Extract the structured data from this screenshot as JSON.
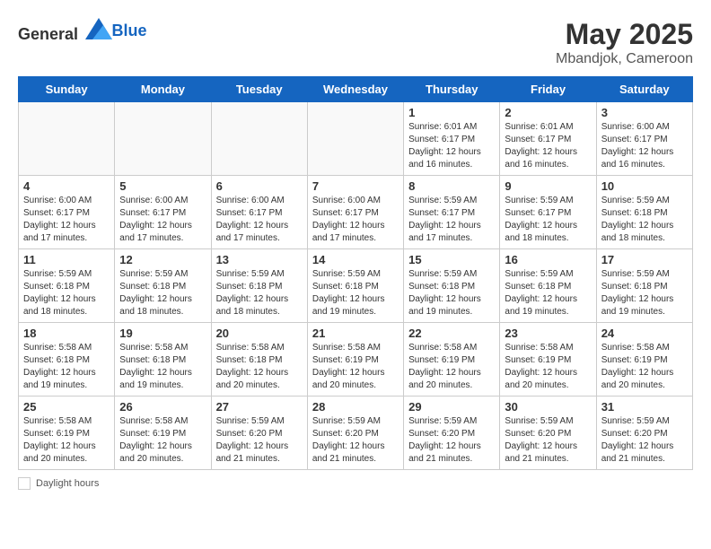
{
  "header": {
    "logo_general": "General",
    "logo_blue": "Blue",
    "month_year": "May 2025",
    "location": "Mbandjok, Cameroon"
  },
  "days_of_week": [
    "Sunday",
    "Monday",
    "Tuesday",
    "Wednesday",
    "Thursday",
    "Friday",
    "Saturday"
  ],
  "weeks": [
    [
      {
        "day": "",
        "info": ""
      },
      {
        "day": "",
        "info": ""
      },
      {
        "day": "",
        "info": ""
      },
      {
        "day": "",
        "info": ""
      },
      {
        "day": "1",
        "info": "Sunrise: 6:01 AM\nSunset: 6:17 PM\nDaylight: 12 hours\nand 16 minutes."
      },
      {
        "day": "2",
        "info": "Sunrise: 6:01 AM\nSunset: 6:17 PM\nDaylight: 12 hours\nand 16 minutes."
      },
      {
        "day": "3",
        "info": "Sunrise: 6:00 AM\nSunset: 6:17 PM\nDaylight: 12 hours\nand 16 minutes."
      }
    ],
    [
      {
        "day": "4",
        "info": "Sunrise: 6:00 AM\nSunset: 6:17 PM\nDaylight: 12 hours\nand 17 minutes."
      },
      {
        "day": "5",
        "info": "Sunrise: 6:00 AM\nSunset: 6:17 PM\nDaylight: 12 hours\nand 17 minutes."
      },
      {
        "day": "6",
        "info": "Sunrise: 6:00 AM\nSunset: 6:17 PM\nDaylight: 12 hours\nand 17 minutes."
      },
      {
        "day": "7",
        "info": "Sunrise: 6:00 AM\nSunset: 6:17 PM\nDaylight: 12 hours\nand 17 minutes."
      },
      {
        "day": "8",
        "info": "Sunrise: 5:59 AM\nSunset: 6:17 PM\nDaylight: 12 hours\nand 17 minutes."
      },
      {
        "day": "9",
        "info": "Sunrise: 5:59 AM\nSunset: 6:17 PM\nDaylight: 12 hours\nand 18 minutes."
      },
      {
        "day": "10",
        "info": "Sunrise: 5:59 AM\nSunset: 6:18 PM\nDaylight: 12 hours\nand 18 minutes."
      }
    ],
    [
      {
        "day": "11",
        "info": "Sunrise: 5:59 AM\nSunset: 6:18 PM\nDaylight: 12 hours\nand 18 minutes."
      },
      {
        "day": "12",
        "info": "Sunrise: 5:59 AM\nSunset: 6:18 PM\nDaylight: 12 hours\nand 18 minutes."
      },
      {
        "day": "13",
        "info": "Sunrise: 5:59 AM\nSunset: 6:18 PM\nDaylight: 12 hours\nand 18 minutes."
      },
      {
        "day": "14",
        "info": "Sunrise: 5:59 AM\nSunset: 6:18 PM\nDaylight: 12 hours\nand 19 minutes."
      },
      {
        "day": "15",
        "info": "Sunrise: 5:59 AM\nSunset: 6:18 PM\nDaylight: 12 hours\nand 19 minutes."
      },
      {
        "day": "16",
        "info": "Sunrise: 5:59 AM\nSunset: 6:18 PM\nDaylight: 12 hours\nand 19 minutes."
      },
      {
        "day": "17",
        "info": "Sunrise: 5:59 AM\nSunset: 6:18 PM\nDaylight: 12 hours\nand 19 minutes."
      }
    ],
    [
      {
        "day": "18",
        "info": "Sunrise: 5:58 AM\nSunset: 6:18 PM\nDaylight: 12 hours\nand 19 minutes."
      },
      {
        "day": "19",
        "info": "Sunrise: 5:58 AM\nSunset: 6:18 PM\nDaylight: 12 hours\nand 19 minutes."
      },
      {
        "day": "20",
        "info": "Sunrise: 5:58 AM\nSunset: 6:18 PM\nDaylight: 12 hours\nand 20 minutes."
      },
      {
        "day": "21",
        "info": "Sunrise: 5:58 AM\nSunset: 6:19 PM\nDaylight: 12 hours\nand 20 minutes."
      },
      {
        "day": "22",
        "info": "Sunrise: 5:58 AM\nSunset: 6:19 PM\nDaylight: 12 hours\nand 20 minutes."
      },
      {
        "day": "23",
        "info": "Sunrise: 5:58 AM\nSunset: 6:19 PM\nDaylight: 12 hours\nand 20 minutes."
      },
      {
        "day": "24",
        "info": "Sunrise: 5:58 AM\nSunset: 6:19 PM\nDaylight: 12 hours\nand 20 minutes."
      }
    ],
    [
      {
        "day": "25",
        "info": "Sunrise: 5:58 AM\nSunset: 6:19 PM\nDaylight: 12 hours\nand 20 minutes."
      },
      {
        "day": "26",
        "info": "Sunrise: 5:58 AM\nSunset: 6:19 PM\nDaylight: 12 hours\nand 20 minutes."
      },
      {
        "day": "27",
        "info": "Sunrise: 5:59 AM\nSunset: 6:20 PM\nDaylight: 12 hours\nand 21 minutes."
      },
      {
        "day": "28",
        "info": "Sunrise: 5:59 AM\nSunset: 6:20 PM\nDaylight: 12 hours\nand 21 minutes."
      },
      {
        "day": "29",
        "info": "Sunrise: 5:59 AM\nSunset: 6:20 PM\nDaylight: 12 hours\nand 21 minutes."
      },
      {
        "day": "30",
        "info": "Sunrise: 5:59 AM\nSunset: 6:20 PM\nDaylight: 12 hours\nand 21 minutes."
      },
      {
        "day": "31",
        "info": "Sunrise: 5:59 AM\nSunset: 6:20 PM\nDaylight: 12 hours\nand 21 minutes."
      }
    ]
  ],
  "footer": {
    "daylight_label": "Daylight hours"
  }
}
